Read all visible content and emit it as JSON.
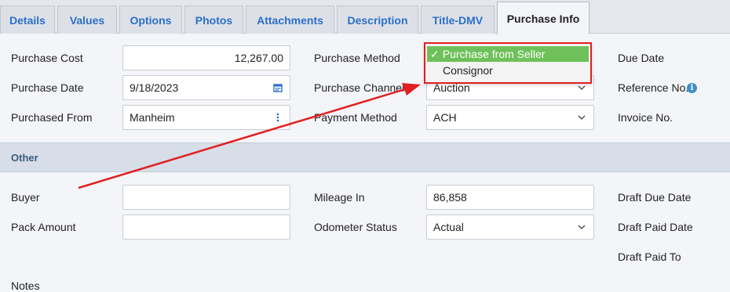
{
  "tabs": [
    "Details",
    "Values",
    "Options",
    "Photos",
    "Attachments",
    "Description",
    "Title-DMV",
    "Purchase Info"
  ],
  "active_tab": "Purchase Info",
  "purchase": {
    "cost_label": "Purchase Cost",
    "cost_value": "12,267.00",
    "date_label": "Purchase Date",
    "date_value": "9/18/2023",
    "from_label": "Purchased From",
    "from_value": "Manheim",
    "method_label": "Purchase Method",
    "channel_label": "Purchase Channel",
    "channel_value": "Auction",
    "payment_label": "Payment Method",
    "payment_value": "ACH",
    "due_date_label": "Due Date",
    "reference_label": "Reference No.",
    "invoice_label": "Invoice No."
  },
  "dropdown": {
    "options": [
      "Purchase from Seller",
      "Consignor"
    ],
    "selected": "Purchase from Seller",
    "check": "✓"
  },
  "other": {
    "section_title": "Other",
    "buyer_label": "Buyer",
    "buyer_value": "",
    "pack_label": "Pack Amount",
    "pack_value": "",
    "mileage_label": "Mileage In",
    "mileage_value": "86,858",
    "odometer_label": "Odometer Status",
    "odometer_value": "Actual",
    "draft_due_label": "Draft Due Date",
    "draft_paid_label": "Draft Paid Date",
    "draft_paid_to_label": "Draft Paid To",
    "notes_label": "Notes"
  },
  "colors": {
    "accent": "#2a6fc9",
    "highlight_green": "#6ec15a",
    "annotation_red": "#e02020",
    "section_bg": "#d7dee8"
  },
  "icons": [
    "calendar-icon",
    "kebab-icon",
    "chevron-down-icon",
    "info-icon"
  ]
}
